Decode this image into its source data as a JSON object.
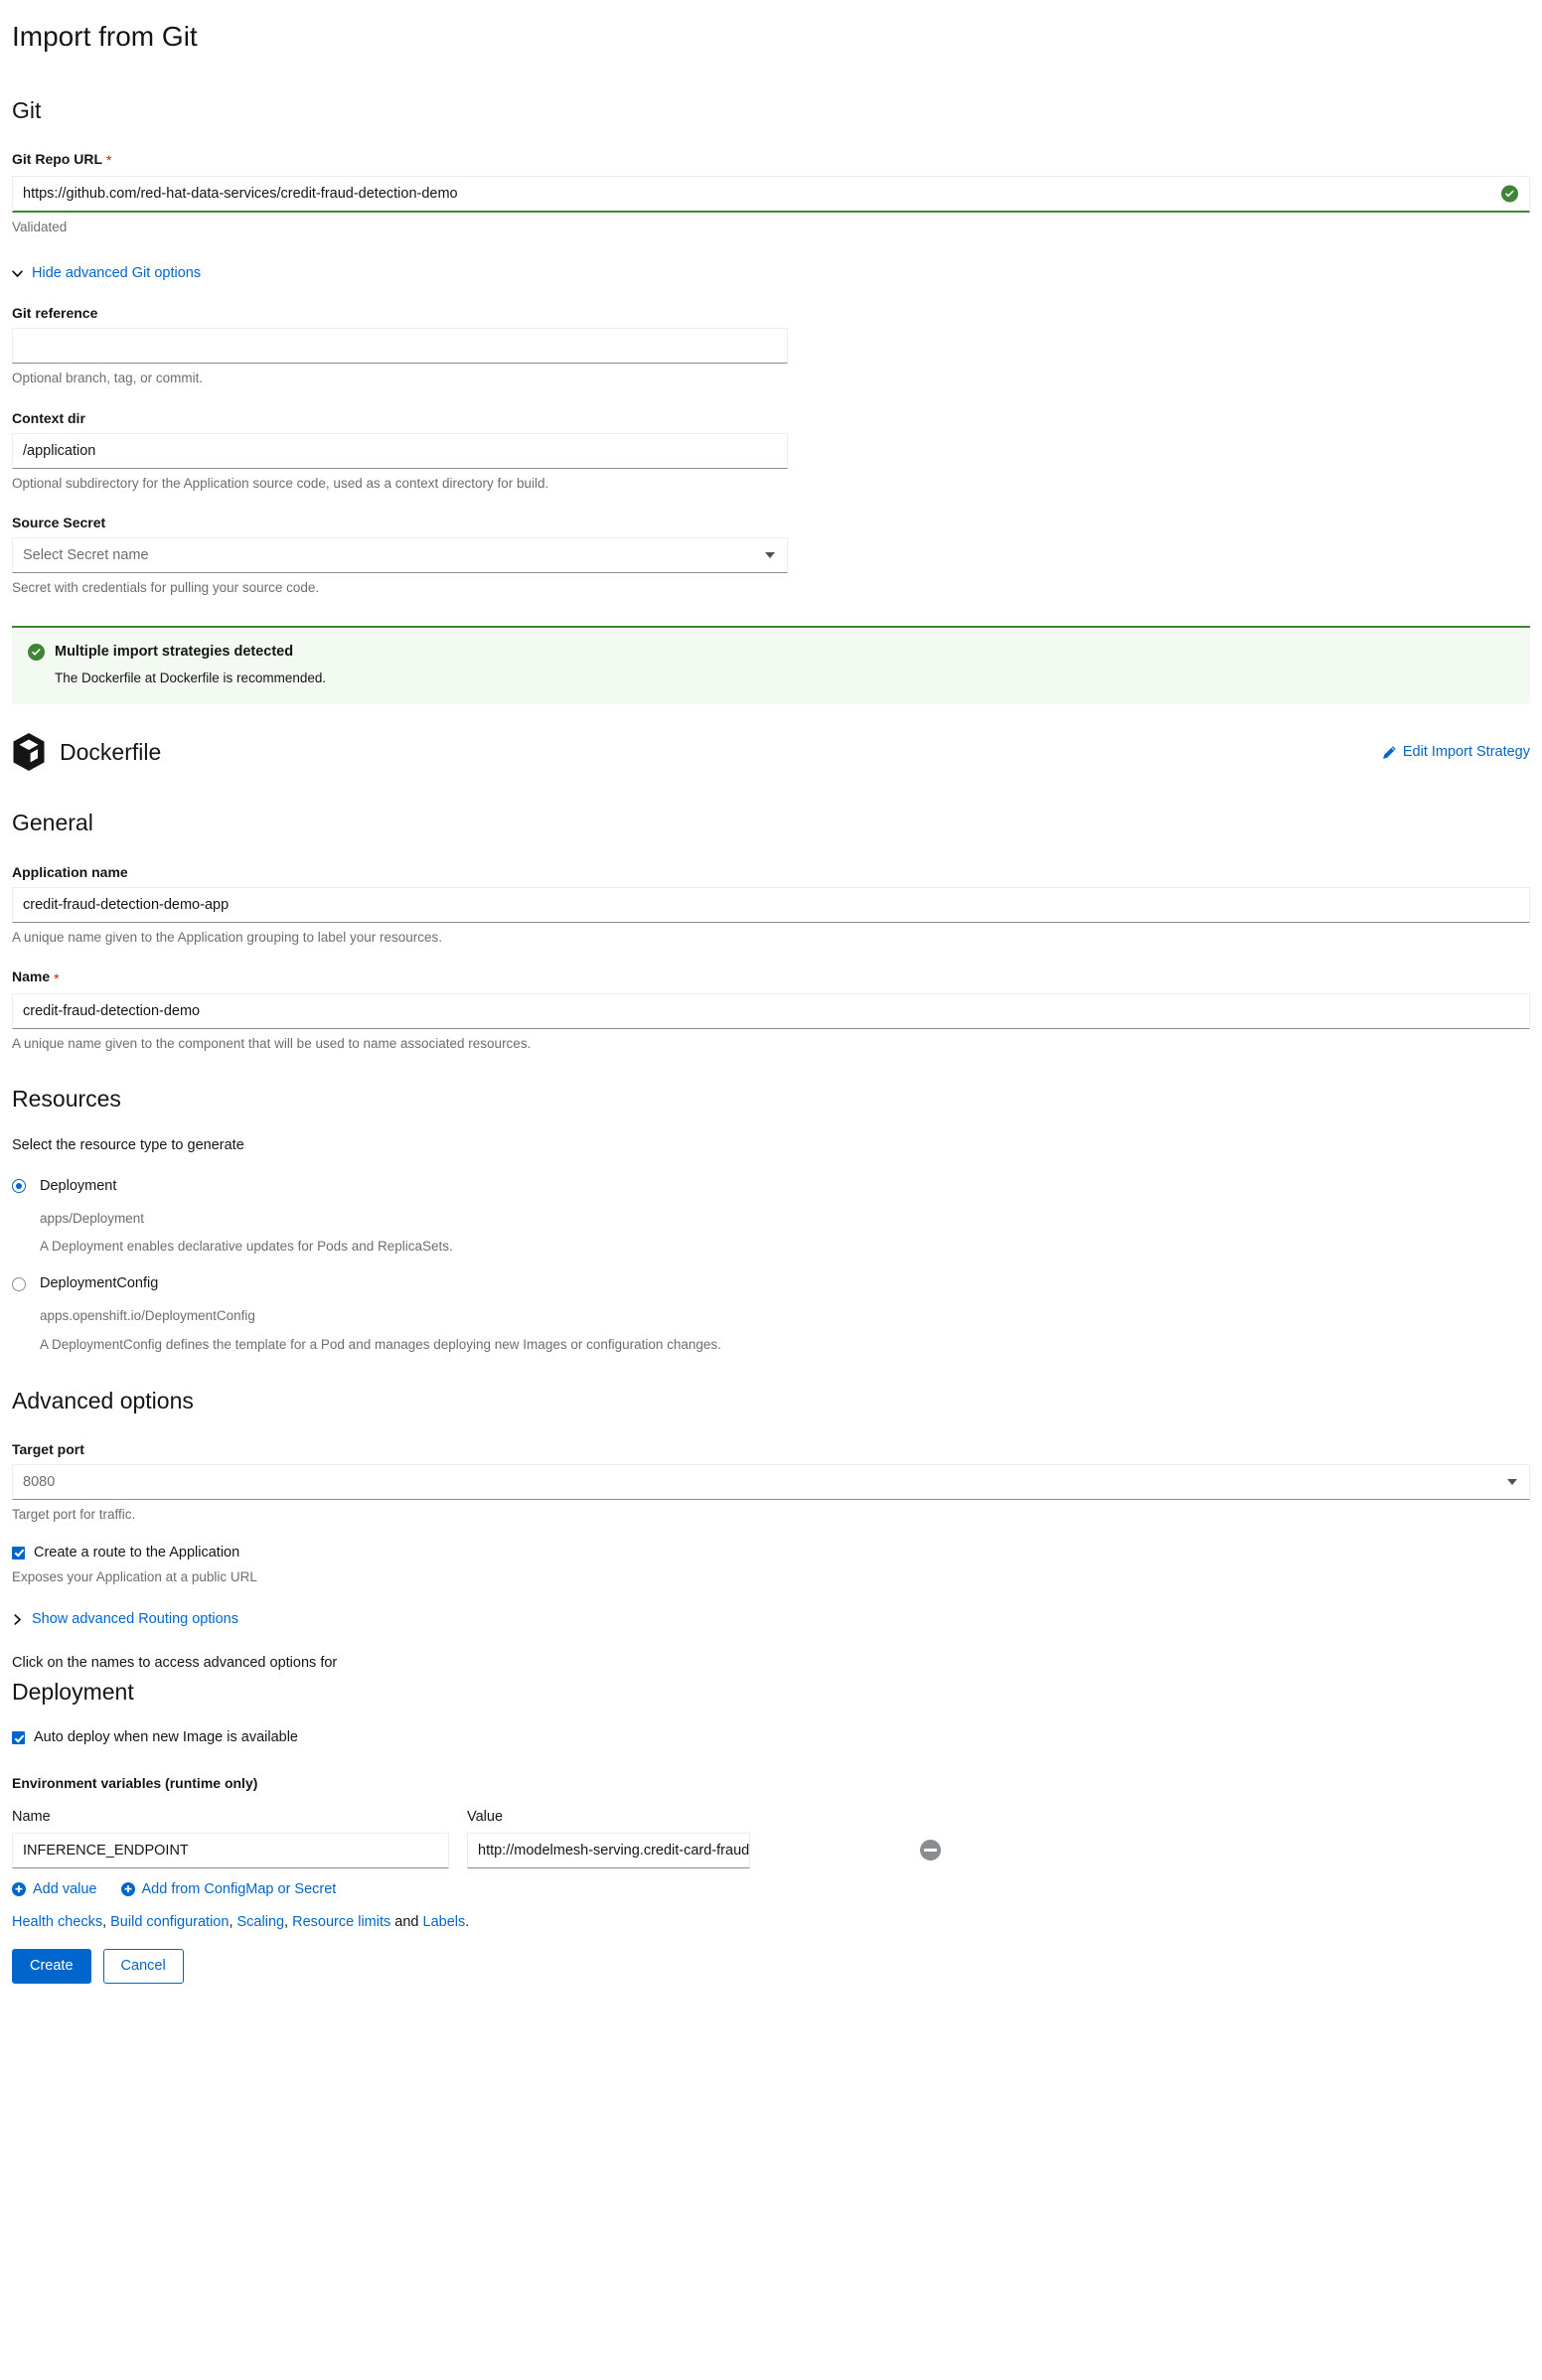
{
  "page": {
    "title": "Import from Git"
  },
  "git_section": {
    "heading": "Git",
    "repo_url": {
      "label": "Git Repo URL",
      "required_marker": "*",
      "value": "https://github.com/red-hat-data-services/credit-fraud-detection-demo",
      "helper": "Validated",
      "status_icon": "check-circle-icon",
      "status_color": "#3e8635"
    },
    "advanced_toggle": {
      "label": "Hide advanced Git options",
      "icon": "chevron-down-icon",
      "expanded": true
    },
    "git_reference": {
      "label": "Git reference",
      "value": "",
      "placeholder": "",
      "helper": "Optional branch, tag, or commit."
    },
    "context_dir": {
      "label": "Context dir",
      "value": "/application",
      "helper": "Optional subdirectory for the Application source code, used as a context directory for build."
    },
    "source_secret": {
      "label": "Source Secret",
      "selected": "Select Secret name",
      "helper": "Secret with credentials for pulling your source code.",
      "icon": "chevron-down-icon"
    }
  },
  "alert": {
    "icon": "check-circle-icon",
    "title": "Multiple import strategies detected",
    "body": "The Dockerfile at Dockerfile is recommended.",
    "accent_color": "#3e8635",
    "background_color": "#f3faf2"
  },
  "strategy": {
    "icon": "dockerfile-cube-icon",
    "name": "Dockerfile",
    "edit_link": {
      "label": "Edit Import Strategy",
      "icon": "pencil-icon"
    }
  },
  "general": {
    "heading": "General",
    "application_name": {
      "label": "Application name",
      "value": "credit-fraud-detection-demo-app",
      "helper": "A unique name given to the Application grouping to label your resources."
    },
    "name": {
      "label": "Name",
      "required_marker": "*",
      "value": "credit-fraud-detection-demo",
      "helper": "A unique name given to the component that will be used to name associated resources."
    }
  },
  "resources": {
    "heading": "Resources",
    "prompt": "Select the resource type to generate",
    "options": [
      {
        "label": "Deployment",
        "api": "apps/Deployment",
        "description": "A Deployment enables declarative updates for Pods and ReplicaSets.",
        "selected": true
      },
      {
        "label": "DeploymentConfig",
        "api": "apps.openshift.io/DeploymentConfig",
        "description": "A DeploymentConfig defines the template for a Pod and manages deploying new Images or configuration changes.",
        "selected": false
      }
    ]
  },
  "advanced_options": {
    "heading": "Advanced options",
    "target_port": {
      "label": "Target port",
      "value": "8080",
      "helper": "Target port for traffic.",
      "icon": "chevron-down-icon"
    },
    "create_route": {
      "label": "Create a route to the Application",
      "checked": true,
      "helper": "Exposes your Application at a public URL"
    },
    "routing_toggle": {
      "label": "Show advanced Routing options",
      "icon": "chevron-right-icon",
      "expanded": false
    }
  },
  "deployment": {
    "prompt": "Click on the names to access advanced options for",
    "heading": "Deployment",
    "auto_deploy": {
      "label": "Auto deploy when new Image is available",
      "checked": true
    },
    "env_vars": {
      "heading": "Environment variables (runtime only)",
      "columns": {
        "name": "Name",
        "value": "Value"
      },
      "rows": [
        {
          "name": "INFERENCE_ENDPOINT",
          "value": "http://modelmesh-serving.credit-card-fraud.svc:...",
          "remove_icon": "minus-circle-icon"
        }
      ],
      "add_value_label": "Add value",
      "add_configmap_label": "Add from ConfigMap or Secret",
      "add_icon": "plus-circle-icon"
    },
    "advanced_links": {
      "items": [
        "Health checks",
        "Build configuration",
        "Scaling",
        "Resource limits",
        "Labels"
      ],
      "separator": ", ",
      "conjunction": " and ",
      "terminator": "."
    }
  },
  "footer": {
    "create_label": "Create",
    "cancel_label": "Cancel",
    "primary_color": "#0066cc"
  }
}
